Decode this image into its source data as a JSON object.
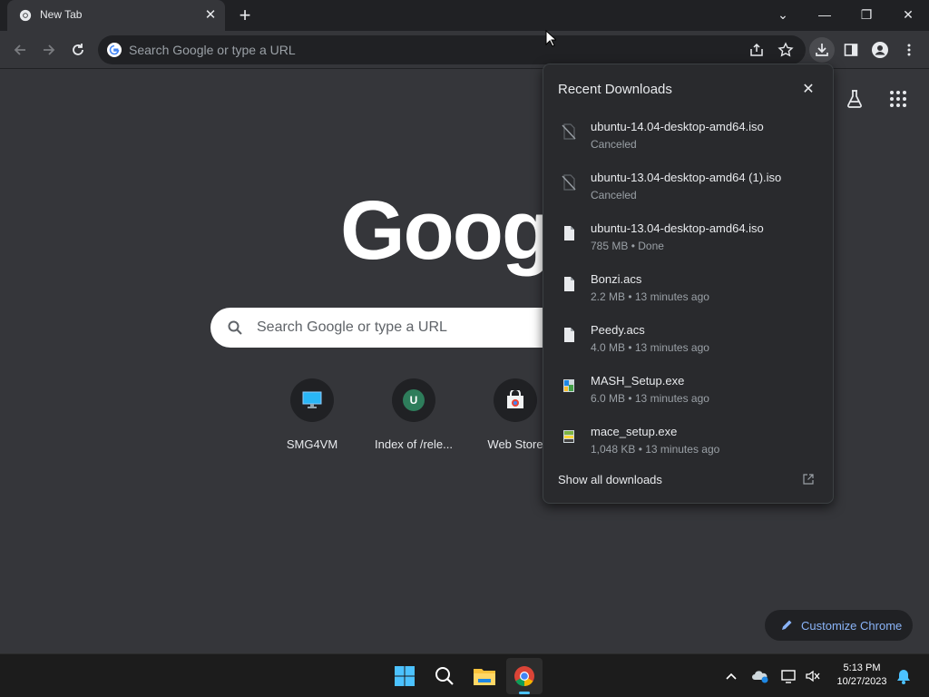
{
  "tab": {
    "title": "New Tab",
    "close_glyph": "✕",
    "new_tab_glyph": "+"
  },
  "window_controls": {
    "tab_search_glyph": "⌄",
    "minimize_glyph": "—",
    "restore_glyph": "❐",
    "close_glyph": "✕"
  },
  "omnibox": {
    "placeholder": "Search Google or type a URL"
  },
  "ntp": {
    "logo_text": "Google",
    "search_placeholder": "Search Google or type a URL",
    "shortcuts": [
      {
        "label": "SMG4VM",
        "icon": "monitor-icon"
      },
      {
        "label": "Index of /rele...",
        "icon": "letter-u-icon",
        "letter": "U"
      },
      {
        "label": "Web Store",
        "icon": "webstore-icon"
      }
    ],
    "customize_label": "Customize Chrome"
  },
  "downloads": {
    "title": "Recent Downloads",
    "close_glyph": "✕",
    "items": [
      {
        "name": "ubuntu-14.04-desktop-amd64.iso",
        "status": "Canceled",
        "icon": "canceled-file-icon"
      },
      {
        "name": "ubuntu-13.04-desktop-amd64 (1).iso",
        "status": "Canceled",
        "icon": "canceled-file-icon"
      },
      {
        "name": "ubuntu-13.04-desktop-amd64.iso",
        "status": "785 MB • Done",
        "icon": "file-icon"
      },
      {
        "name": "Bonzi.acs",
        "status": "2.2 MB • 13 minutes ago",
        "icon": "file-icon"
      },
      {
        "name": "Peedy.acs",
        "status": "4.0 MB • 13 minutes ago",
        "icon": "file-icon"
      },
      {
        "name": "MASH_Setup.exe",
        "status": "6.0 MB • 13 minutes ago",
        "icon": "installer-icon"
      },
      {
        "name": "mace_setup.exe",
        "status": "1,048 KB • 13 minutes ago",
        "icon": "installer-icon"
      }
    ],
    "show_all_label": "Show all downloads"
  },
  "taskbar": {
    "time": "5:13 PM",
    "date": "10/27/2023"
  },
  "colors": {
    "frame": "#202124",
    "toolbar": "#35363a",
    "bubble": "#292a2d",
    "accent": "#8ab4f8",
    "windows_blue": "#0078d4"
  }
}
